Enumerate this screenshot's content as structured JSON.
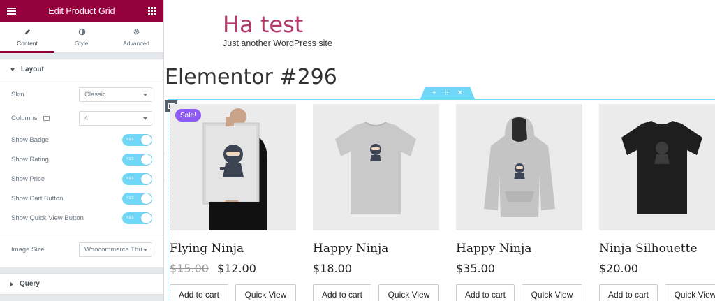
{
  "panel": {
    "title": "Edit Product Grid",
    "tabs": [
      {
        "label": "Content",
        "icon": "pencil-icon",
        "active": true
      },
      {
        "label": "Style",
        "icon": "contrast-icon",
        "active": false
      },
      {
        "label": "Advanced",
        "icon": "gear-icon",
        "active": false
      }
    ],
    "layout_section": "Layout",
    "query_section": "Query",
    "skin": {
      "label": "Skin",
      "value": "Classic"
    },
    "columns": {
      "label": "Columns",
      "value": "4"
    },
    "toggles": [
      {
        "label": "Show Badge",
        "state": "YES"
      },
      {
        "label": "Show Rating",
        "state": "YES"
      },
      {
        "label": "Show Price",
        "state": "YES"
      },
      {
        "label": "Show Cart Button",
        "state": "YES"
      },
      {
        "label": "Show Quick View Button",
        "state": "YES"
      }
    ],
    "image_size": {
      "label": "Image Size",
      "value": "Woocommerce Thu"
    }
  },
  "site": {
    "title": "Ha test",
    "tagline": "Just another WordPress site",
    "page_title": "Elementor #296"
  },
  "products": [
    {
      "name": "Flying Ninja",
      "old_price": "$15.00",
      "price": "$12.00",
      "badge": "Sale!",
      "cart": "Add to cart",
      "quick_view": "Quick View"
    },
    {
      "name": "Happy Ninja",
      "price": "$18.00",
      "cart": "Add to cart",
      "quick_view": "Quick View"
    },
    {
      "name": "Happy Ninja",
      "price": "$35.00",
      "cart": "Add to cart",
      "quick_view": "Quick View"
    },
    {
      "name": "Ninja Silhouette",
      "price": "$20.00",
      "cart": "Add to cart",
      "quick_view": "Quick View"
    }
  ],
  "colors": {
    "panel_header": "#93003c",
    "accent": "#71d7f7",
    "badge": "#8e5cf4",
    "site_title": "#b23a6a"
  }
}
